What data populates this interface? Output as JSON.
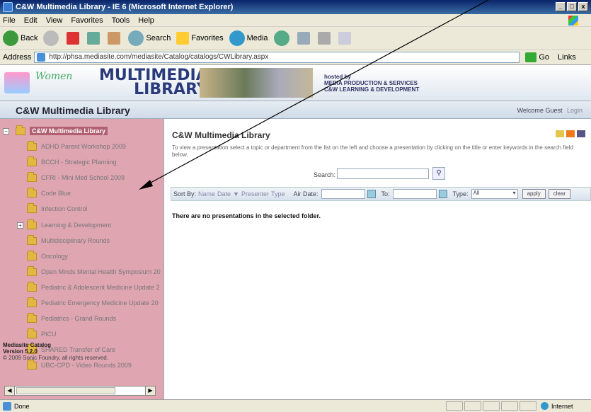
{
  "window": {
    "title": "C&W Multimedia Library - IE 6 (Microsoft Internet Explorer)",
    "buttons": [
      "_",
      "□",
      "x"
    ]
  },
  "menu": [
    "File",
    "Edit",
    "View",
    "Favorites",
    "Tools",
    "Help"
  ],
  "toolbar": {
    "back": "Back",
    "search": "Search",
    "favorites": "Favorites",
    "media": "Media"
  },
  "address": {
    "label": "Address",
    "url": "http://phsa.mediasite.com/mediasite/Catalog/catalogs/CWLibrary.aspx",
    "go": "Go",
    "links": "Links"
  },
  "banner": {
    "brand": "Women",
    "title_line1": "MULTIMEDIA",
    "title_line2": "LIBRARY",
    "hosted_line1": "hosted by",
    "hosted_line2": "MEDIA PRODUCTION & SERVICES",
    "hosted_line3": "C&W LEARNING & DEVELOPMENT"
  },
  "header": {
    "title": "C&W Multimedia Library",
    "welcome": "Welcome Guest",
    "login": "Login"
  },
  "sidebar": {
    "root": "C&W Multimedia Library",
    "items": [
      "ADHD Parent Workshop 2009",
      "BCCH - Strategic Planning",
      "CFRI - Mini Med School 2009",
      "Code Blue",
      "Infection Control",
      "Learning & Development",
      "Multidisciplinary Rounds",
      "Oncology",
      "Open Minds Mental Health Symposium 20",
      "Pediatric & Adolescent Medicine Update 2",
      "Pediatric Emergency Medicine Update 20",
      "Pediatrics - Grand Rounds",
      "PICU",
      "SHARED Transfer of Care",
      "UBC-CPD - Video Rounds 2009"
    ],
    "expandable": "+",
    "catalog_line1": "Mediasite Catalog",
    "catalog_line2": "Version 5.2.0",
    "catalog_line3": "© 2009 Sonic Foundry, all rights reserved."
  },
  "content": {
    "title": "C&W Multimedia Library",
    "description": "To view a presentation select a topic or department from the list on the left and choose a presentation by clicking on the title or enter keywords in the search field below.",
    "search_label": "Search:",
    "sort_label": "Sort By:",
    "sort_name": "Name",
    "sort_date": "Date",
    "sort_presenter": "Presenter",
    "sort_type": "Type",
    "air_date": "Air Date:",
    "to": "To:",
    "type": "Type:",
    "type_value": "All",
    "apply": "apply",
    "clear": "clear",
    "empty": "There are no presentations in the selected folder."
  },
  "status": {
    "left": "Done",
    "zone": "Internet"
  }
}
